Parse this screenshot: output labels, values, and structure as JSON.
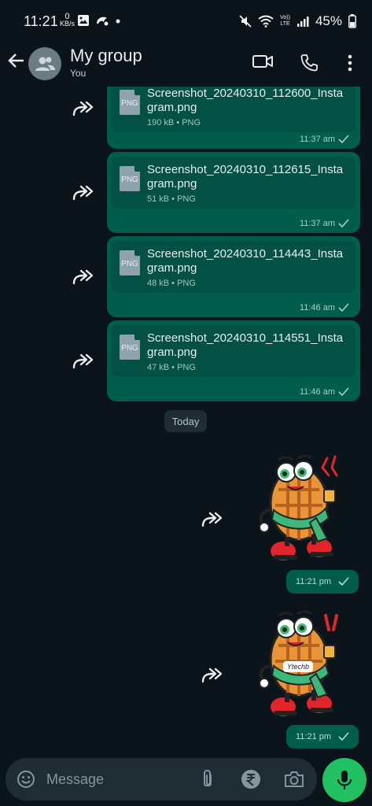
{
  "status_bar": {
    "time": "11:21",
    "net_speed_value": "0",
    "net_speed_unit": "KB/s",
    "battery": "45%",
    "network_label_top": "Vo))",
    "network_label_bottom": "LTE"
  },
  "header": {
    "title": "My group",
    "subtitle": "You"
  },
  "messages": [
    {
      "file_name": "Screenshot_20240310_112600_Instagram.png",
      "meta": "190 kB • PNG",
      "time": "11:37 am",
      "icon_label": "PNG"
    },
    {
      "file_name": "Screenshot_20240310_112615_Instagram.png",
      "meta": "51 kB • PNG",
      "time": "11:37 am",
      "icon_label": "PNG"
    },
    {
      "file_name": "Screenshot_20240310_114443_Instagram.png",
      "meta": "48 kB • PNG",
      "time": "11:46 am",
      "icon_label": "PNG"
    },
    {
      "file_name": "Screenshot_20240310_114551_Instagram.png",
      "meta": "47 kB • PNG",
      "time": "11:46 am",
      "icon_label": "PNG"
    }
  ],
  "date_divider": "Today",
  "stickers": [
    {
      "time": "11:21 pm"
    },
    {
      "time": "11:21 pm",
      "badge_text": "Ytechb"
    }
  ],
  "composer": {
    "placeholder": "Message"
  },
  "colors": {
    "background": "#0b141a",
    "bubble": "#005c4b",
    "accent": "#21c063"
  }
}
